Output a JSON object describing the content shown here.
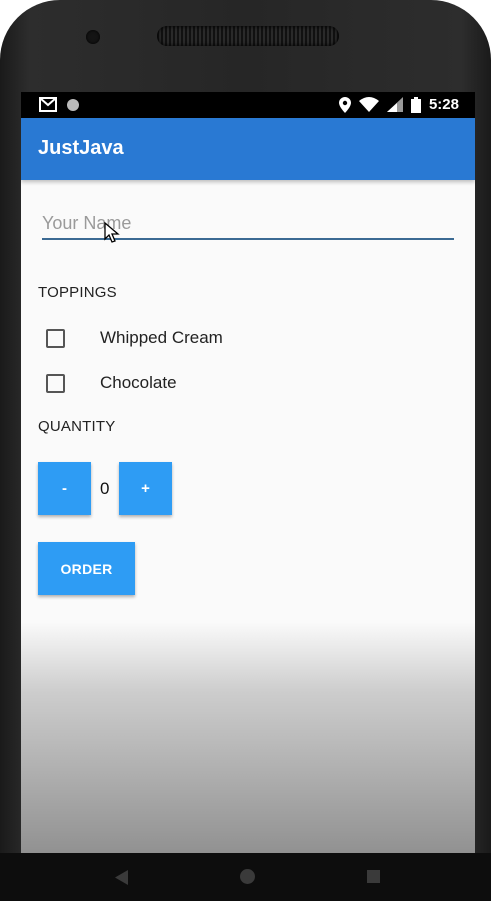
{
  "status_bar": {
    "time": "5:28",
    "left_icons": [
      "gmail-icon",
      "notification-dot-icon"
    ],
    "right_icons": [
      "location-icon",
      "wifi-icon",
      "signal-icon",
      "battery-icon"
    ]
  },
  "app_bar": {
    "title": "JustJava",
    "color": "#2979d3"
  },
  "name_input": {
    "placeholder": "Your Name",
    "value": ""
  },
  "toppings": {
    "label": "TOPPINGS",
    "options": [
      {
        "label": "Whipped Cream",
        "checked": false
      },
      {
        "label": "Chocolate",
        "checked": false
      }
    ]
  },
  "quantity": {
    "label": "QUANTITY",
    "decrement_label": "-",
    "value": "0",
    "increment_label": "+"
  },
  "order_button": {
    "label": "ORDER",
    "color": "#2e9cf4"
  },
  "navigation": {
    "icons": [
      "back-icon",
      "home-icon",
      "recent-apps-icon"
    ]
  }
}
